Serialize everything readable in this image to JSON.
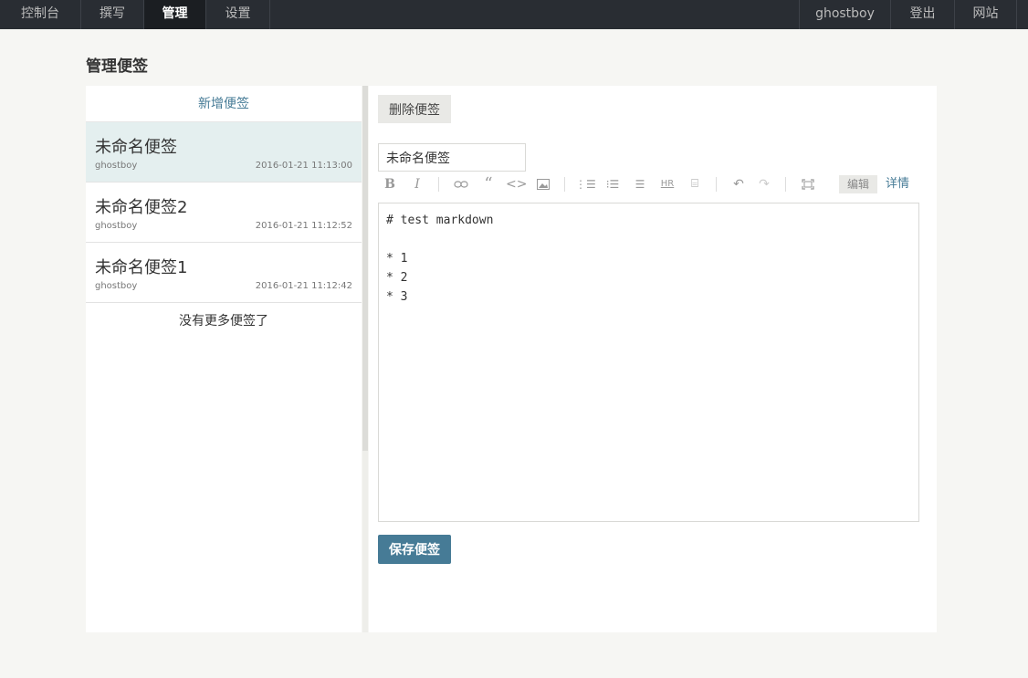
{
  "nav": {
    "left": [
      "控制台",
      "撰写",
      "管理",
      "设置"
    ],
    "active": "管理",
    "user": "ghostboy",
    "logout": "登出",
    "site": "网站"
  },
  "page": {
    "title": "管理便签"
  },
  "sidebar": {
    "add_label": "新增便签",
    "notes": [
      {
        "title": "未命名便签",
        "author": "ghostboy",
        "time": "2016-01-21 11:13:00",
        "selected": true
      },
      {
        "title": "未命名便签2",
        "author": "ghostboy",
        "time": "2016-01-21 11:12:52",
        "selected": false
      },
      {
        "title": "未命名便签1",
        "author": "ghostboy",
        "time": "2016-01-21 11:12:42",
        "selected": false
      }
    ],
    "no_more": "没有更多便签了"
  },
  "editor": {
    "delete_label": "删除便签",
    "title_value": "未命名便签",
    "content": "# test markdown\n\n* 1\n* 2\n* 3",
    "edit_tab": "编辑",
    "preview_tab": "详情",
    "save_label": "保存便签"
  },
  "toolbar_icons": [
    "bold-icon",
    "italic-icon",
    "link-icon",
    "quote-icon",
    "code-icon",
    "image-icon",
    "ordered-list-icon",
    "unordered-list-icon",
    "title-icon",
    "hr-icon",
    "more-icon",
    "undo-icon",
    "redo-icon",
    "fullscreen-icon"
  ],
  "colors": {
    "accent": "#467b96",
    "nav_bg": "#292d33",
    "selected_bg": "#e4efef"
  }
}
